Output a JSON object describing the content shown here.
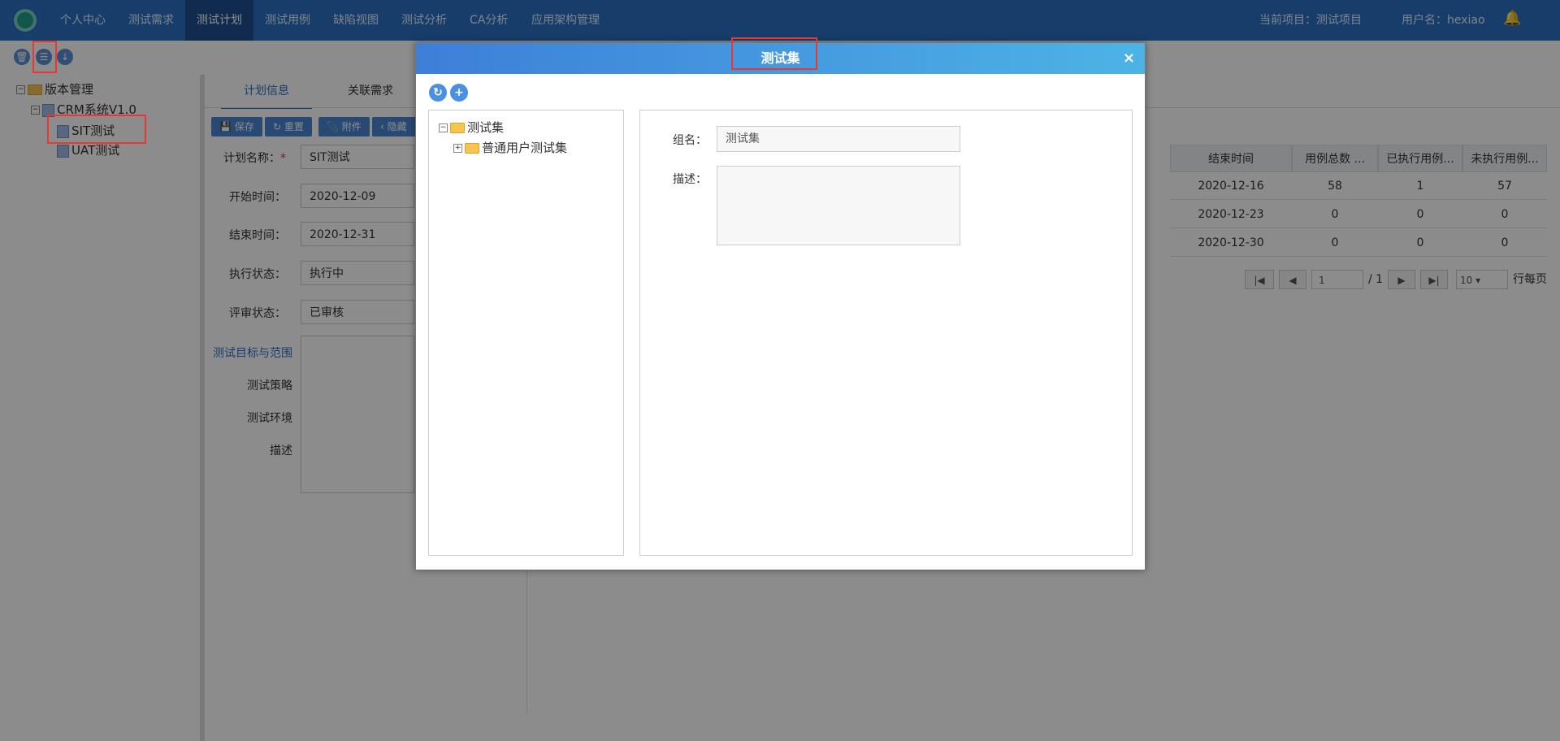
{
  "nav": {
    "items": [
      "个人中心",
      "测试需求",
      "测试计划",
      "测试用例",
      "缺陷视图",
      "测试分析",
      "CA分析",
      "应用架构管理"
    ],
    "active_index": 2,
    "current_project": "当前项目：测试项目",
    "username": "用户名：hexiao",
    "icons": [
      "logo-icon",
      "bell-icon"
    ]
  },
  "toolbar": {
    "icons": [
      "delete-icon",
      "list-icon",
      "download-icon"
    ]
  },
  "tree": {
    "root": "版本管理",
    "version": "CRM系统V1.0",
    "plans": [
      "SIT测试",
      "UAT测试"
    ]
  },
  "tabs": [
    "计划信息",
    "关联需求"
  ],
  "buttons": [
    "保存",
    "重置",
    "附件",
    "隐藏"
  ],
  "form": {
    "plan_name_label": "计划名称：",
    "required_mark": "*",
    "plan_name": "SIT测试",
    "start_label": "开始时间：",
    "start": "2020-12-09",
    "end_label": "结束时间：",
    "end": "2020-12-31",
    "exec_label": "执行状态：",
    "exec": "执行中",
    "review_label": "评审状态：",
    "review": "已审核",
    "sections": [
      "测试目标与范围",
      "测试策略",
      "测试环境",
      "描述"
    ]
  },
  "table": {
    "headers": [
      "结束时间",
      "用例总数 ...",
      "已执行用例...",
      "未执行用例..."
    ],
    "rows": [
      [
        "2020-12-16",
        "58",
        "1",
        "57"
      ],
      [
        "2020-12-23",
        "0",
        "0",
        "0"
      ],
      [
        "2020-12-30",
        "0",
        "0",
        "0"
      ]
    ]
  },
  "pagination": {
    "page": "1",
    "total": "/ 1",
    "page_size": "10",
    "per_page_label": "行每页"
  },
  "modal": {
    "title": "测试集",
    "close": "×",
    "tree_root": "测试集",
    "tree_child": "普通用户测试集",
    "group_label": "组名：",
    "group_placeholder": "测试集",
    "desc_label": "描述："
  }
}
